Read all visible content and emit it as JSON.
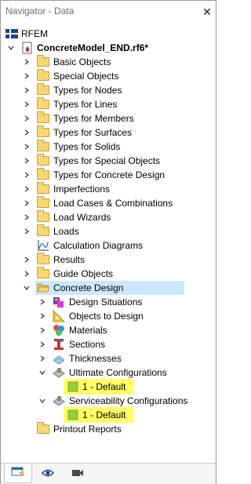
{
  "window": {
    "title": "Navigator - Data",
    "close_glyph": "✕"
  },
  "tree": {
    "root": "RFEM",
    "model": "ConcreteModel_END.rf6*",
    "items": [
      {
        "label": "Basic Objects",
        "icon": "folder-icon"
      },
      {
        "label": "Special Objects",
        "icon": "folder-icon"
      },
      {
        "label": "Types for Nodes",
        "icon": "folder-icon"
      },
      {
        "label": "Types for Lines",
        "icon": "folder-icon"
      },
      {
        "label": "Types for Members",
        "icon": "folder-icon"
      },
      {
        "label": "Types for Surfaces",
        "icon": "folder-icon"
      },
      {
        "label": "Types for Solids",
        "icon": "folder-icon"
      },
      {
        "label": "Types for Special Objects",
        "icon": "folder-icon"
      },
      {
        "label": "Types for Concrete Design",
        "icon": "folder-icon"
      },
      {
        "label": "Imperfections",
        "icon": "folder-icon"
      },
      {
        "label": "Load Cases & Combinations",
        "icon": "folder-icon"
      },
      {
        "label": "Load Wizards",
        "icon": "folder-icon"
      },
      {
        "label": "Loads",
        "icon": "folder-icon"
      },
      {
        "label": "Calculation Diagrams",
        "icon": "diagram-icon"
      },
      {
        "label": "Results",
        "icon": "folder-icon"
      },
      {
        "label": "Guide Objects",
        "icon": "folder-icon"
      }
    ],
    "concrete_design": {
      "label": "Concrete Design",
      "children": [
        {
          "label": "Design Situations",
          "icon": "design-situations-icon"
        },
        {
          "label": "Objects to Design",
          "icon": "objects-to-design-icon"
        },
        {
          "label": "Materials",
          "icon": "materials-icon"
        },
        {
          "label": "Sections",
          "icon": "sections-icon"
        },
        {
          "label": "Thicknesses",
          "icon": "thicknesses-icon"
        }
      ],
      "uls": {
        "label": "Ultimate Configurations",
        "child": "1 - Default"
      },
      "sls": {
        "label": "Serviceability Configurations",
        "child": "1 - Default"
      }
    },
    "printout": "Printout Reports"
  },
  "bottom_tabs": [
    "data-tab",
    "view-tab",
    "camera-tab"
  ],
  "colors": {
    "folder": "#f7d774",
    "selection": "#cce8ff",
    "highlight": "#ffff66",
    "config_item": "#9ccc3c"
  }
}
